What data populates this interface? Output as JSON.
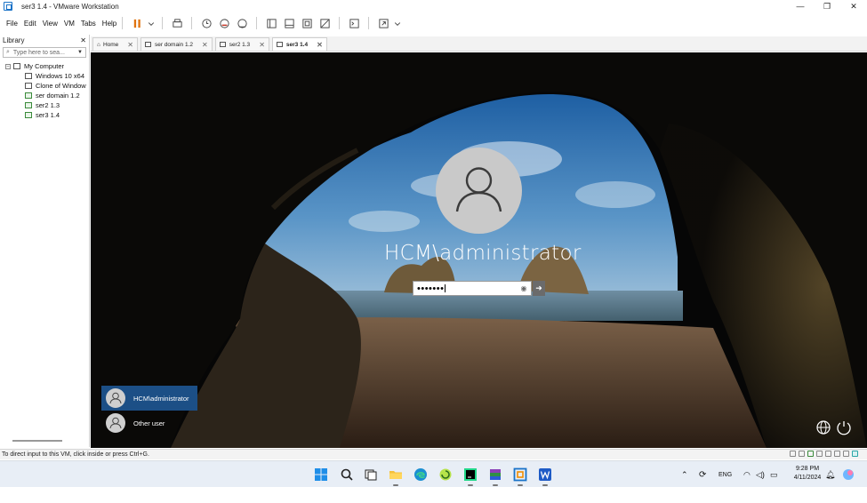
{
  "window": {
    "title": "ser3 1.4 - VMware Workstation",
    "minimize": "—",
    "restore": "❐",
    "close": "✕"
  },
  "menu": [
    "File",
    "Edit",
    "View",
    "VM",
    "Tabs",
    "Help"
  ],
  "library": {
    "title": "Library",
    "close": "✕",
    "search_placeholder": "Type here to sea...",
    "root": "My Computer",
    "items": [
      "Windows 10 x64",
      "Clone of Window",
      "ser domain 1.2",
      "ser2 1.3",
      "ser3 1.4"
    ]
  },
  "tabs": [
    {
      "label": "Home",
      "active": false
    },
    {
      "label": "ser domain 1.2",
      "active": false
    },
    {
      "label": "ser2 1.3",
      "active": false
    },
    {
      "label": "ser3 1.4",
      "active": true
    }
  ],
  "login": {
    "username": "HCM\\administrator",
    "password_mask": "•••••••",
    "users": [
      "HCM\\administrator",
      "Other user"
    ]
  },
  "statusbar": {
    "message": "To direct input to this VM, click inside or press Ctrl+G."
  },
  "taskbar": {
    "language": "ENG",
    "time": "9:28 PM",
    "date": "4/11/2024"
  },
  "colors": {
    "selected_user_tile": "#1c4f86",
    "taskbar_bg": "#e8eef6"
  }
}
